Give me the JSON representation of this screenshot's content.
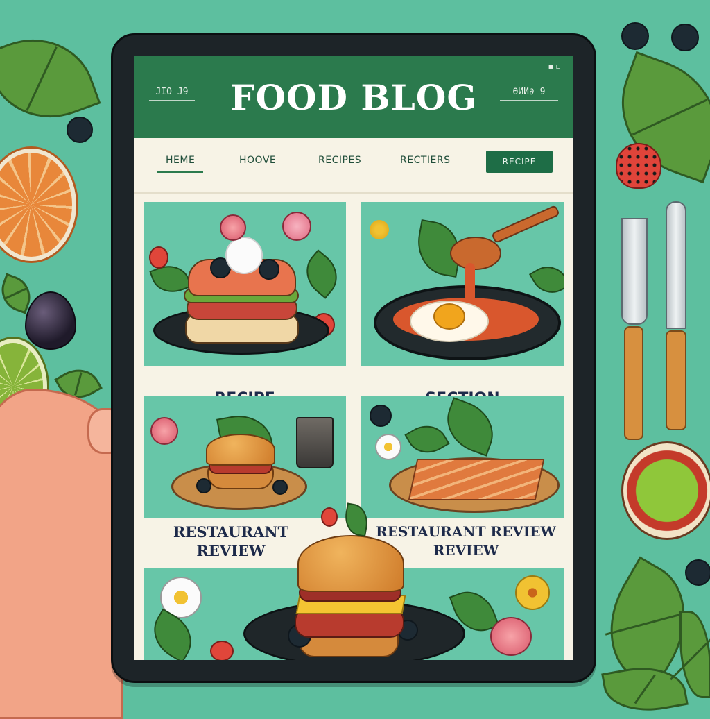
{
  "header": {
    "title": "FOOD BLOG",
    "left_badge": "JIO J9",
    "right_badge": "ΘИИ∂ 9"
  },
  "nav": {
    "items": [
      {
        "label": "HEME",
        "active": true
      },
      {
        "label": "HOOVE",
        "active": false
      },
      {
        "label": "RECIPES",
        "active": false
      },
      {
        "label": "RECTIERS",
        "active": false
      }
    ],
    "button_label": "RECIPE"
  },
  "cards": [
    {
      "label": "RECIPE"
    },
    {
      "label": "SECTION"
    },
    {
      "label_line1": "RESTAURANT",
      "label_line2": "REVIEW"
    },
    {
      "label_line1": "RESTAURANT REVIEW",
      "label_line2": "REVIEW"
    }
  ],
  "colors": {
    "background": "#5dbf9f",
    "header_green": "#2b7a4d",
    "card_teal": "#67c6a8",
    "nav_button": "#1e6d46",
    "label_navy": "#1d2a4a"
  }
}
